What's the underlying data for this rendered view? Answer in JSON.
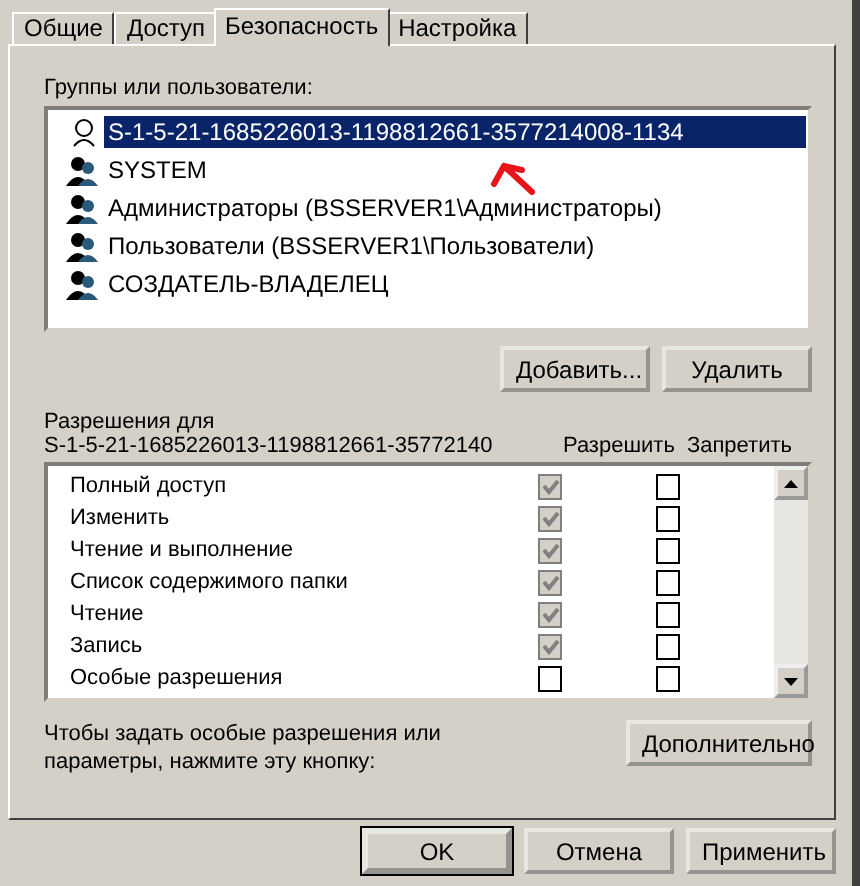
{
  "tabs": [
    {
      "label": "Общие",
      "selected": false
    },
    {
      "label": "Доступ",
      "selected": false
    },
    {
      "label": "Безопасность",
      "selected": true
    },
    {
      "label": "Настройка",
      "selected": false
    }
  ],
  "groups_label": "Группы или пользователи:",
  "users": [
    {
      "name": "S-1-5-21-1685226013-1198812661-3577214008-1134",
      "kind": "unknown",
      "selected": true
    },
    {
      "name": "SYSTEM",
      "kind": "group",
      "selected": false
    },
    {
      "name": "Администраторы (BSSERVER1\\Администраторы)",
      "kind": "group",
      "selected": false
    },
    {
      "name": "Пользователи (BSSERVER1\\Пользователи)",
      "kind": "group",
      "selected": false
    },
    {
      "name": "СОЗДАТЕЛЬ-ВЛАДЕЛЕЦ",
      "kind": "group",
      "selected": false
    }
  ],
  "user_buttons": [
    "Добавить...",
    "Удалить"
  ],
  "permissions_label": "Разрешения для",
  "permissions_for": "S-1-5-21-1685226013-1198812661-35772140",
  "columns": [
    "Разрешить",
    "Запретить"
  ],
  "permissions": [
    {
      "name": "Полный доступ",
      "allow": true,
      "deny": false
    },
    {
      "name": "Изменить",
      "allow": true,
      "deny": false
    },
    {
      "name": "Чтение и выполнение",
      "allow": true,
      "deny": false
    },
    {
      "name": "Список содержимого папки",
      "allow": true,
      "deny": false
    },
    {
      "name": "Чтение",
      "allow": true,
      "deny": false
    },
    {
      "name": "Запись",
      "allow": true,
      "deny": false
    },
    {
      "name": "Особые разрешения",
      "allow": false,
      "deny": false
    }
  ],
  "advanced_hint": "Чтобы задать особые разрешения или параметры, нажмите эту кнопку:",
  "advanced_button": "Дополнительно",
  "dialog_buttons": [
    "OK",
    "Отмена",
    "Применить"
  ]
}
